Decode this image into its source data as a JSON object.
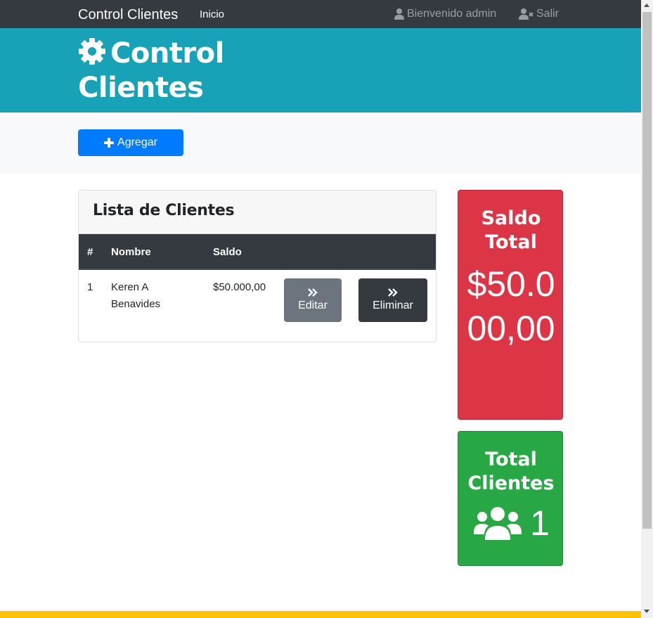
{
  "navbar": {
    "brand": "Control Clientes",
    "home": "Inicio",
    "welcome": "Bienvenido admin",
    "logout": "Salir"
  },
  "header": {
    "title": "Control Clientes"
  },
  "actions": {
    "add_label": "Agregar"
  },
  "clients_list": {
    "title": "Lista de Clientes",
    "columns": [
      "#",
      "Nombre",
      "Saldo"
    ],
    "rows": [
      {
        "index": "1",
        "name": "Keren A Benavides",
        "balance": "$50.000,00",
        "edit_label": "Editar",
        "delete_label": "Eliminar"
      }
    ]
  },
  "summary": {
    "saldo_title": "Saldo Total",
    "saldo_value": "$50.000,00",
    "clients_title": "Total Clientes",
    "clients_value": "1"
  },
  "icons": {
    "header": "gear-icon",
    "welcome": "user-icon",
    "logout": "user-times-icon",
    "add": "plus-icon",
    "row_action": "angle-double-right-icon",
    "clients": "users-icon"
  },
  "colors": {
    "navbar": "#343a40",
    "header": "#17a2b8",
    "primary": "#007bff",
    "secondary": "#6c757d",
    "danger": "#dc3545",
    "success": "#28a745",
    "warning": "#ffc107"
  }
}
